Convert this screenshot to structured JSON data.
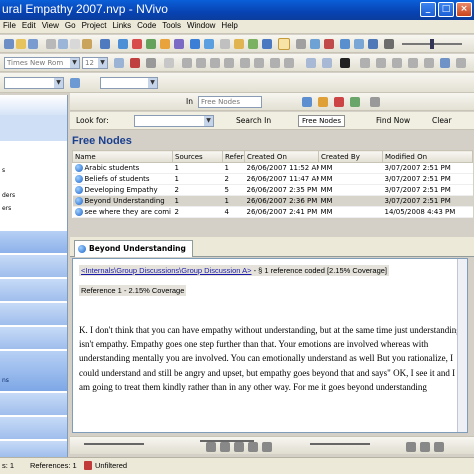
{
  "window": {
    "title": "ural Empathy 2007.nvp - NVivo"
  },
  "menu": [
    "File",
    "Edit",
    "View",
    "Go",
    "Project",
    "Links",
    "Code",
    "Tools",
    "Window",
    "Help"
  ],
  "toolbar": {
    "font_name": "Times New Rom",
    "font_size": "12",
    "in_label": "In",
    "in_value": "Free Nodes"
  },
  "findbar": {
    "look_for_label": "Look for:",
    "search_in_label": "Search In",
    "search_in_value": "Free Nodes",
    "find_now": "Find Now",
    "clear": "Clear"
  },
  "left_panel": {
    "items": [
      "s",
      "ders",
      "ers"
    ],
    "bottom_item": "ns"
  },
  "nodes": {
    "title": "Free Nodes",
    "columns": [
      "Name",
      "Sources",
      "Refer",
      "Created On",
      "Created By",
      "Modified On"
    ],
    "rows": [
      {
        "name": "Arabic students",
        "sources": "1",
        "refs": "1",
        "created_on": "26/06/2007 11:52 AM",
        "created_by": "MM",
        "modified_on": "3/07/2007 2:51 PM",
        "selected": false
      },
      {
        "name": "Beliefs of students",
        "sources": "1",
        "refs": "2",
        "created_on": "26/06/2007 11:47 AM",
        "created_by": "MM",
        "modified_on": "3/07/2007 2:51 PM",
        "selected": false
      },
      {
        "name": "Developing Empathy",
        "sources": "2",
        "refs": "5",
        "created_on": "26/06/2007 2:35 PM",
        "created_by": "MM",
        "modified_on": "3/07/2007 2:51 PM",
        "selected": false
      },
      {
        "name": "Beyond Understanding",
        "sources": "1",
        "refs": "1",
        "created_on": "26/06/2007 2:36 PM",
        "created_by": "MM",
        "modified_on": "3/07/2007 2:51 PM",
        "selected": true
      },
      {
        "name": "see where they are comi",
        "sources": "2",
        "refs": "4",
        "created_on": "26/06/2007 2:41 PM",
        "created_by": "MM",
        "modified_on": "14/05/2008 4:43 PM",
        "selected": false
      }
    ]
  },
  "detail": {
    "tab_label": "Beyond Understanding",
    "source_link": "<Internals\\Group Discussions\\Group Discussion A>",
    "source_suffix": " - § 1 reference coded  [2.15% Coverage]",
    "reference_label": "Reference 1 - 2.15% Coverage",
    "body_text": "K. I don't think that you can have empathy without understanding, but at the same time just understanding isn't empathy. Empathy goes one step further than that. Your emotions are involved whereas with understanding mentally you are involved.  You can emotionally understand as well But you rationalize, I could understand and still be angry and upset, but empathy goes beyond that and says\" OK, I see it and I am going to treat them kindly rather than in any other way. For me it goes beyond understanding"
  },
  "statusbar": {
    "items": "s: 1",
    "references": "References: 1",
    "state": "Unfiltered"
  }
}
